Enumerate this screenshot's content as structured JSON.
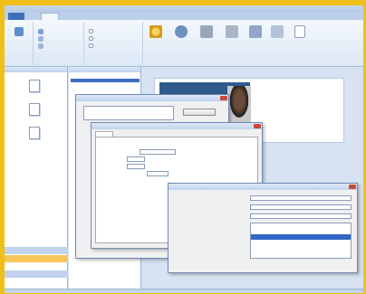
{
  "window": {
    "title": ""
  },
  "tabs": [
    "",
    "",
    "",
    "",
    "",
    ""
  ],
  "ribbon": {
    "groups": [
      {
        "label": "",
        "items": [
          ""
        ]
      },
      {
        "label": "",
        "items": [
          "",
          "",
          ""
        ]
      },
      {
        "label": "",
        "items": [
          "",
          "",
          ""
        ]
      },
      {
        "label": "",
        "items": [
          "",
          "",
          "",
          "",
          "",
          "",
          ""
        ]
      }
    ]
  },
  "left_pane": {
    "header": "",
    "items": [
      "",
      "",
      ""
    ],
    "bottom_items": [
      "",
      "",
      ""
    ]
  },
  "mid_pane": {
    "header": "",
    "rows": [
      "",
      "",
      "",
      "",
      "",
      "",
      "",
      "",
      "",
      ""
    ]
  },
  "preview": {
    "card_title": "",
    "text_lines": [
      "",
      "",
      "",
      "",
      ""
    ]
  },
  "dialog_back": {
    "title": "",
    "options": [
      "",
      ""
    ],
    "button": ""
  },
  "dialog_mid": {
    "title": "",
    "tab": "",
    "section": "",
    "fields": [
      {
        "label": "",
        "value": ""
      },
      {
        "label": "",
        "value": ""
      },
      {
        "label": "",
        "value": ""
      },
      {
        "label": "",
        "value": ""
      }
    ]
  },
  "dialog_front": {
    "title": "",
    "fields": [
      {
        "label": "",
        "value": ""
      },
      {
        "label": "",
        "value": ""
      },
      {
        "label": "",
        "value": ""
      },
      {
        "label": "",
        "value": ""
      }
    ],
    "list_options": [
      "",
      "",
      "",
      "",
      ""
    ]
  },
  "colors": {
    "frame": "#f0c01a",
    "accent": "#3167c6",
    "ribbon": "#dce7f5"
  }
}
